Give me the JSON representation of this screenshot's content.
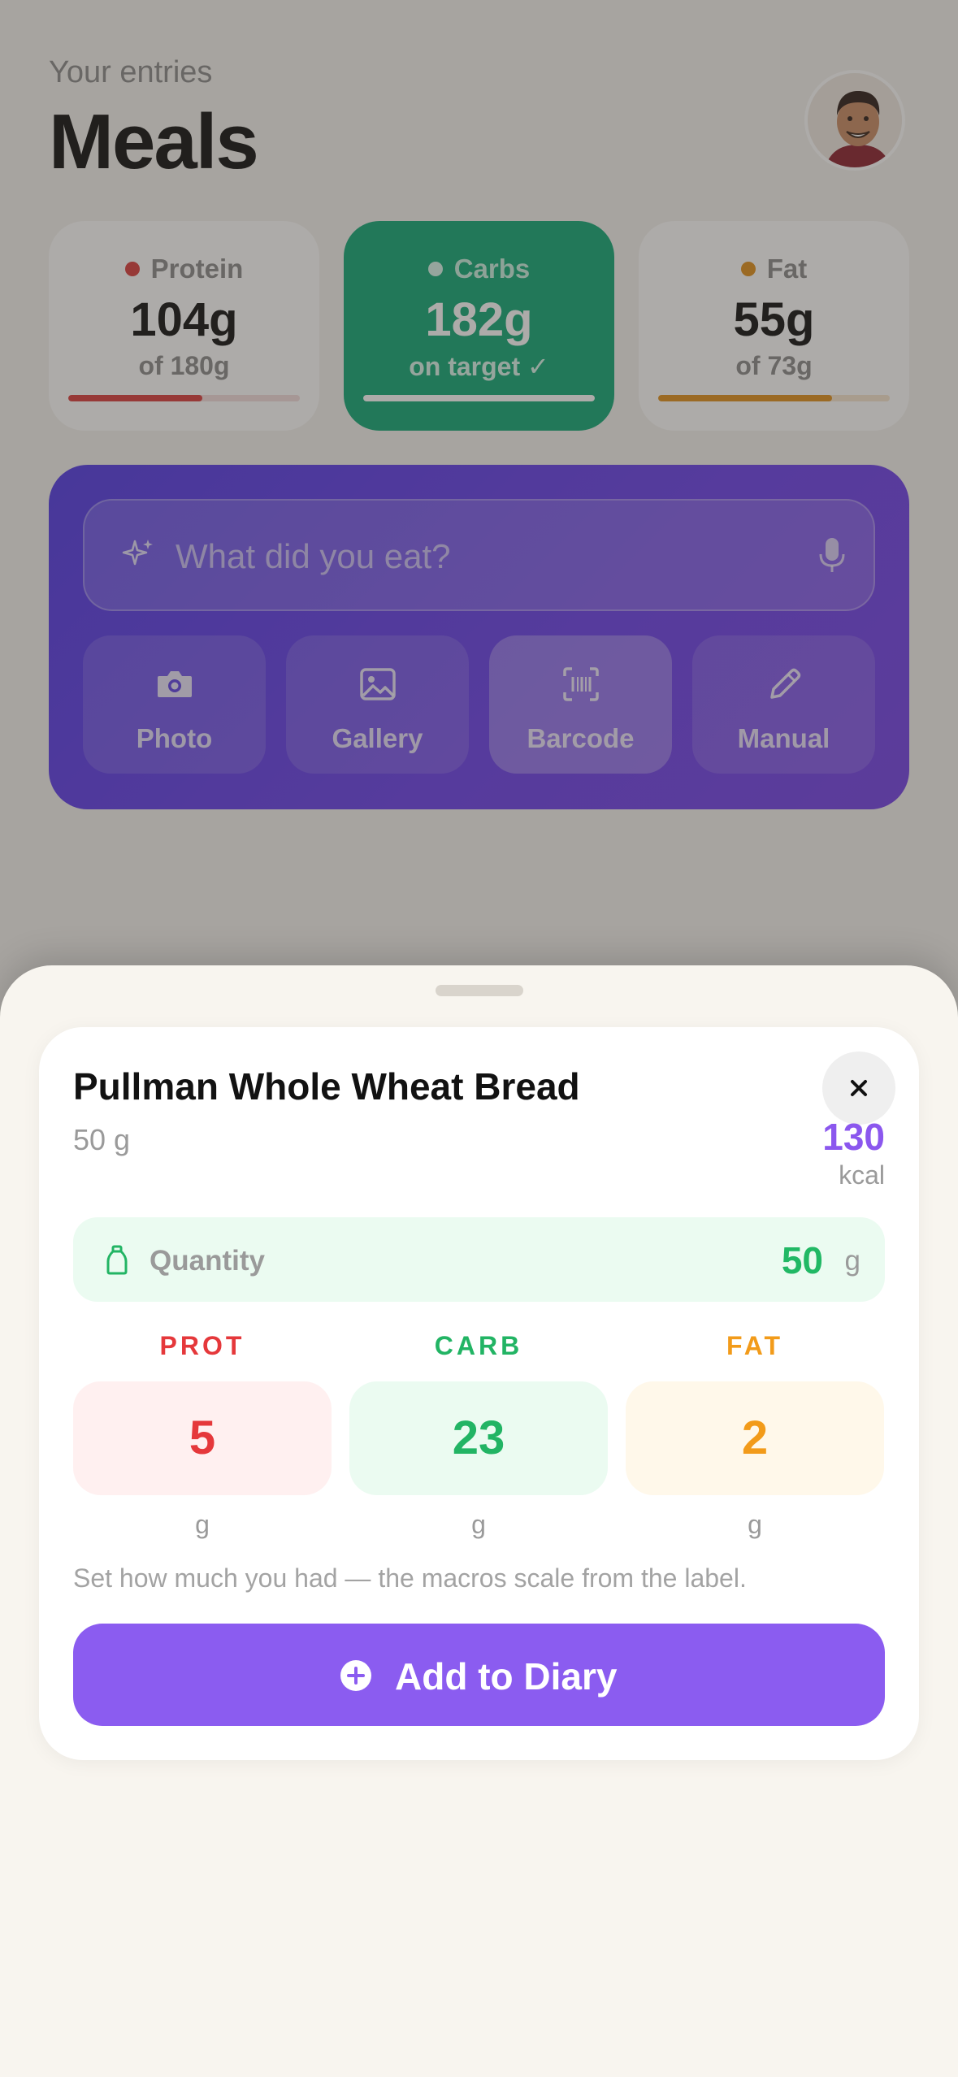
{
  "header": {
    "subtitle": "Your entries",
    "title": "Meals"
  },
  "macros": [
    {
      "name": "Protein",
      "value": "104g",
      "sub": "of 180g",
      "color": "#d93b3b",
      "progress": 0.58
    },
    {
      "name": "Carbs",
      "value": "182g",
      "sub": "on target ✓",
      "color": "#11a876",
      "progress": 1.0
    },
    {
      "name": "Fat",
      "value": "55g",
      "sub": "of 73g",
      "color": "#e0901a",
      "progress": 0.75
    }
  ],
  "logger": {
    "placeholder": "What did you eat?",
    "tools": [
      {
        "label": "Photo",
        "icon": "camera-icon"
      },
      {
        "label": "Gallery",
        "icon": "image-icon"
      },
      {
        "label": "Barcode",
        "icon": "barcode-scan-icon",
        "active": true
      },
      {
        "label": "Manual",
        "icon": "pencil-icon"
      }
    ]
  },
  "sheet": {
    "food_name": "Pullman Whole Wheat Bread",
    "serving": "50 g",
    "kcal_value": "130",
    "kcal_unit": "kcal",
    "quantity_label": "Quantity",
    "quantity_value": "50",
    "quantity_unit": "g",
    "macros": [
      {
        "label": "PROT",
        "value": "5",
        "unit": "g"
      },
      {
        "label": "CARB",
        "value": "23",
        "unit": "g"
      },
      {
        "label": "FAT",
        "value": "2",
        "unit": "g"
      }
    ],
    "hint": "Set how much you had — the macros scale from the label.",
    "add_label": "Add to Diary"
  },
  "colors": {
    "accent": "#8b5cf0",
    "panel": "#5b3de8",
    "green": "#22b464",
    "red": "#e5383b",
    "orange": "#f29b1a"
  }
}
